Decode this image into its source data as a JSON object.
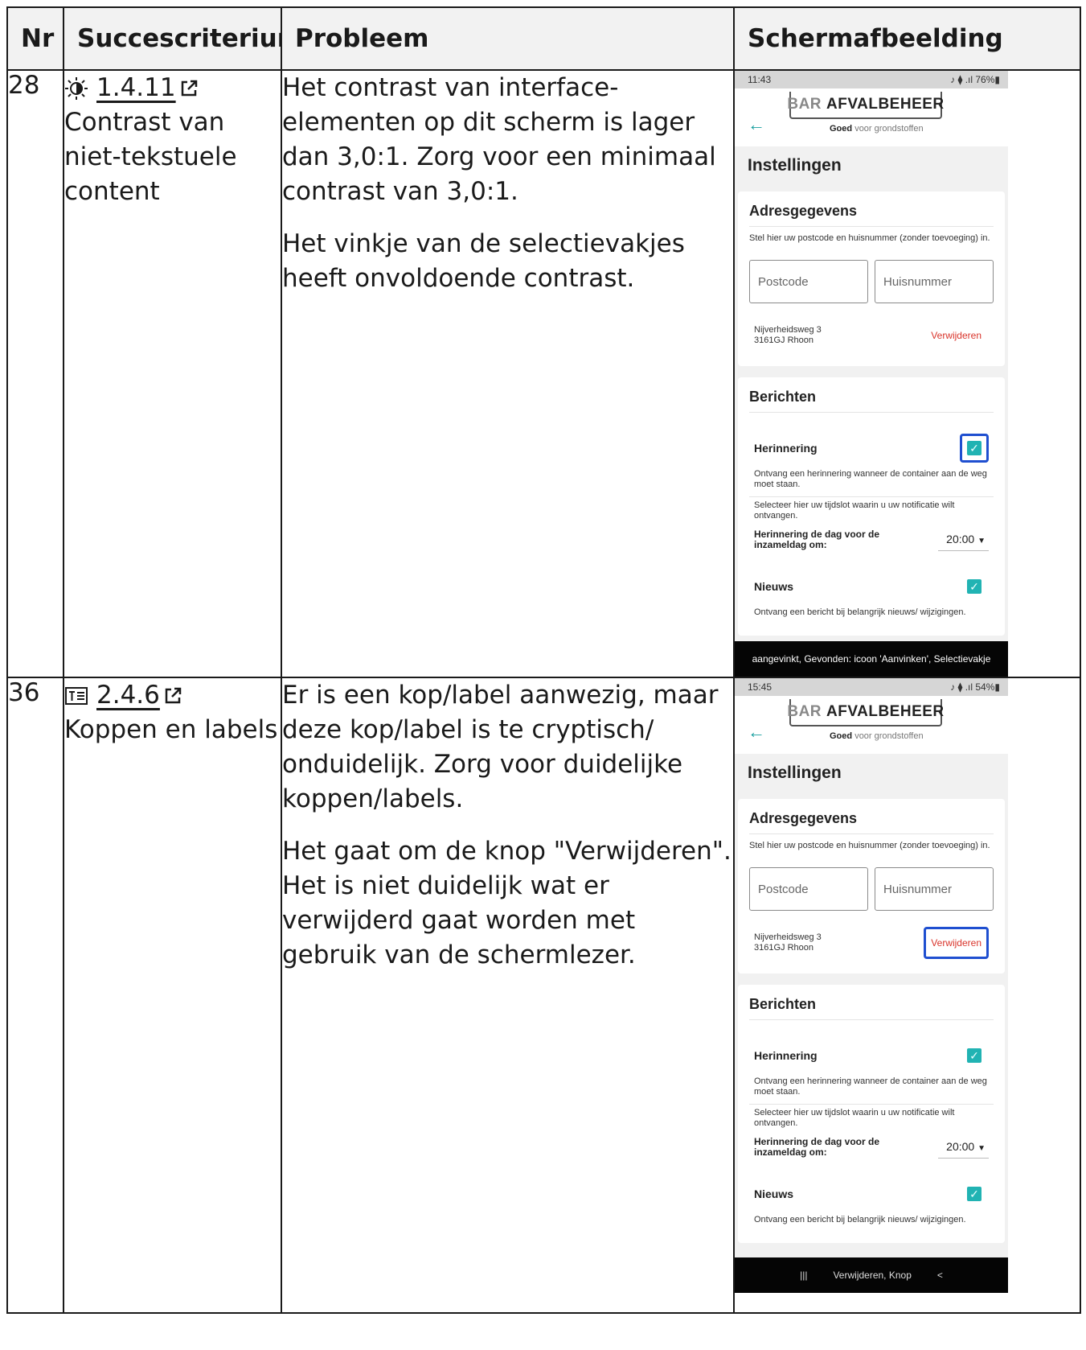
{
  "table": {
    "headers": {
      "nr": "Nr",
      "criterium": "Succescriterium",
      "probleem": "Probleem",
      "screenshot": "Schermafbeelding"
    },
    "rows": [
      {
        "nr": "28",
        "crit_icon": "contrast-icon",
        "crit_code": "1.4.11",
        "crit_name": "Contrast van niet-tekstuele content",
        "problem_p1": "Het contrast van interface-elementen op dit scherm is lager dan 3,0:1. Zorg voor een minimaal contrast van 3,0:1.",
        "problem_p2": "Het vinkje van de selectievakjes heeft onvoldoende contrast.",
        "phone": {
          "time": "11:43",
          "status_right": "♪ ⧫ .ıl 76%▮",
          "overlay": "aangevinkt, Gevonden: icoon 'Aanvinken', Selectievakje"
        }
      },
      {
        "nr": "36",
        "crit_icon": "headings-icon",
        "crit_code": "2.4.6",
        "crit_name": "Koppen en labels",
        "problem_p1": "Er is een kop/label aanwezig, maar deze kop/label is te cryptisch/ onduidelijk. Zorg voor duidelijke koppen/labels.",
        "problem_p2": "Het gaat om de knop \"Verwijderen\". Het is niet duidelijk wat er verwijderd gaat worden met gebruik van de schermlezer.",
        "phone": {
          "time": "15:45",
          "status_right": "♪ ⧫ .ıl 54%▮",
          "overlay": "Verwijderen, Knop",
          "nav_recent": "|||",
          "nav_back": "<"
        }
      }
    ]
  },
  "app": {
    "logo_bar": "BAR",
    "logo_name": "AFVALBEHEER",
    "tagline_bold": "Goed",
    "tagline_rest": "voor grondstoffen",
    "page_title": "Instellingen",
    "address_heading": "Adresgegevens",
    "address_help": "Stel hier uw postcode en huisnummer (zonder toevoeging) in.",
    "postcode_placeholder": "Postcode",
    "huisnummer_placeholder": "Huisnummer",
    "address_line1": "Nijverheidsweg 3",
    "address_line2": "3161GJ Rhoon",
    "remove_label": "Verwijderen",
    "messages_heading": "Berichten",
    "reminder_title": "Herinnering",
    "reminder_desc": "Ontvang een herinnering wanneer de container aan de weg moet staan.",
    "timeslot_help": "Selecteer hier uw tijdslot waarin u uw notificatie wilt ontvangen.",
    "time_label": "Herinnering de dag voor de inzameldag om:",
    "time_value": "20:00",
    "news_title": "Nieuws",
    "news_desc": "Ontvang een bericht bij belangrijk nieuws/ wijzigingen.",
    "checkbox_mark": "✓",
    "accent": "#21b3b3",
    "highlight": "#1f4fd0",
    "remove_color": "#d9342b"
  }
}
